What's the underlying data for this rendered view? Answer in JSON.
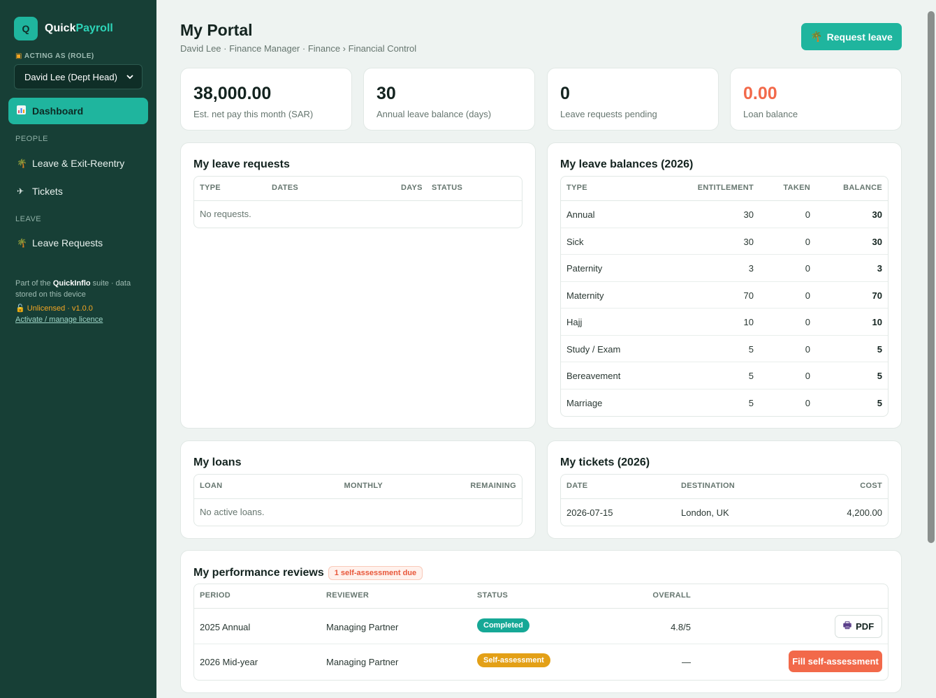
{
  "sidebar": {
    "brand_initial": "Q",
    "brand_part1": "Quick",
    "brand_part2": "Payroll",
    "role_label": "ACTING AS (ROLE)",
    "role_value": "David Lee (Dept Head)",
    "nav_active": "Dashboard",
    "section_people": "PEOPLE",
    "nav_leave_exit": "Leave & Exit-Reentry",
    "nav_tickets": "Tickets",
    "section_leave": "LEAVE",
    "nav_leave_requests": "Leave Requests",
    "footer_part1": "Part of the",
    "footer_suite": "QuickInflo",
    "footer_part2": "suite · data stored on this device",
    "licence_status": "Unlicensed · v1.0.0",
    "licence_link": "Activate / manage licence"
  },
  "header": {
    "title": "My Portal",
    "breadcrumb": "David Lee · Finance Manager · Finance › Financial Control",
    "request_leave": "Request leave"
  },
  "stats": [
    {
      "value": "38,000.00",
      "label": "Est. net pay this month (SAR)"
    },
    {
      "value": "30",
      "label": "Annual leave balance (days)"
    },
    {
      "value": "0",
      "label": "Leave requests pending"
    },
    {
      "value": "0.00",
      "label": "Loan balance"
    }
  ],
  "leave_requests": {
    "title": "My leave requests",
    "headers": [
      "TYPE",
      "DATES",
      "DAYS",
      "STATUS"
    ],
    "empty": "No requests."
  },
  "leave_balances": {
    "title": "My leave balances (2026)",
    "headers": [
      "TYPE",
      "ENTITLEMENT",
      "TAKEN",
      "BALANCE"
    ],
    "rows": [
      {
        "type": "Annual",
        "entitlement": "30",
        "taken": "0",
        "balance": "30"
      },
      {
        "type": "Sick",
        "entitlement": "30",
        "taken": "0",
        "balance": "30"
      },
      {
        "type": "Paternity",
        "entitlement": "3",
        "taken": "0",
        "balance": "3"
      },
      {
        "type": "Maternity",
        "entitlement": "70",
        "taken": "0",
        "balance": "70"
      },
      {
        "type": "Hajj",
        "entitlement": "10",
        "taken": "0",
        "balance": "10"
      },
      {
        "type": "Study / Exam",
        "entitlement": "5",
        "taken": "0",
        "balance": "5"
      },
      {
        "type": "Bereavement",
        "entitlement": "5",
        "taken": "0",
        "balance": "5"
      },
      {
        "type": "Marriage",
        "entitlement": "5",
        "taken": "0",
        "balance": "5"
      }
    ]
  },
  "loans": {
    "title": "My loans",
    "headers": [
      "LOAN",
      "MONTHLY",
      "REMAINING"
    ],
    "empty": "No active loans."
  },
  "tickets": {
    "title": "My tickets (2026)",
    "headers": [
      "DATE",
      "DESTINATION",
      "COST"
    ],
    "rows": [
      {
        "date": "2026-07-15",
        "destination": "London, UK",
        "cost": "4,200.00"
      }
    ]
  },
  "reviews": {
    "title": "My performance reviews",
    "badge": "1 self-assessment due",
    "headers": [
      "PERIOD",
      "REVIEWER",
      "STATUS",
      "OVERALL"
    ],
    "rows": [
      {
        "period": "2025 Annual",
        "reviewer": "Managing Partner",
        "status": "Completed",
        "overall": "4.8/5",
        "action": "PDF"
      },
      {
        "period": "2026 Mid-year",
        "reviewer": "Managing Partner",
        "status": "Self-assessment",
        "overall": "—",
        "action": "Fill self-assessment"
      }
    ]
  },
  "colors": {
    "sidebar": "#173f36",
    "accent": "#1fb59e",
    "danger": "#f2694a",
    "warning": "#e3a017"
  }
}
